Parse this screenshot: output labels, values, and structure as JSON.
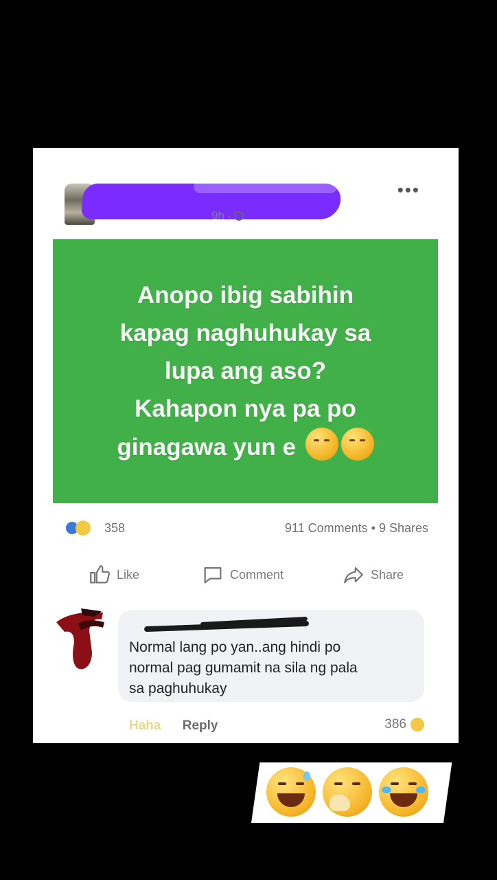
{
  "post": {
    "time": "9h ·",
    "text_lines": [
      "Anopo ibig sabihin",
      "kapag naghuhukay sa",
      "lupa ang aso?",
      "Kahapon nya pa po",
      "ginagawa yun e"
    ],
    "reaction_count": "358",
    "comments_shares": "911 Comments • 9 Shares",
    "image_bg": "#42b049"
  },
  "actions": {
    "like_label": "Like",
    "comment_label": "Comment",
    "share_label": "Share"
  },
  "comment": {
    "text_line1": "Normal lang po yan..ang hindi po",
    "text_line2": "normal pag gumamit na sila ng pala",
    "text_line3": "sa paghuhukay",
    "haha_label": "Haha",
    "reply_label": "Reply",
    "reaction_count": "386"
  },
  "icons": {
    "more": "more-options-icon",
    "globe": "globe-icon",
    "like": "thumbs-up-icon",
    "comment": "comment-bubble-icon",
    "share": "share-arrow-icon"
  }
}
